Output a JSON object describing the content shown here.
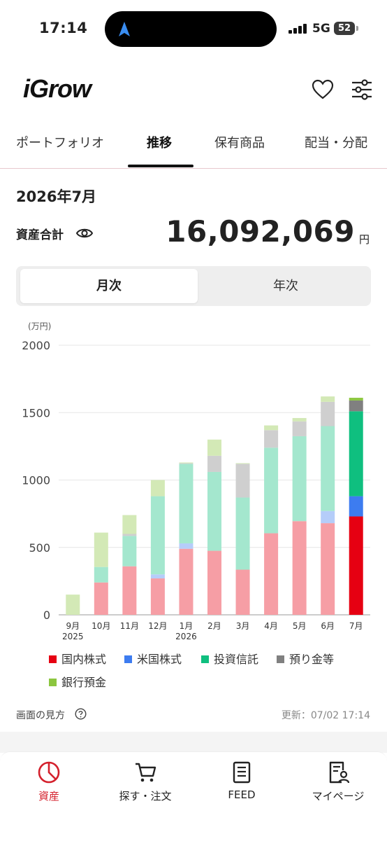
{
  "status": {
    "time": "17:14",
    "network": "5G",
    "battery": "52"
  },
  "app": {
    "logo": "iGrow",
    "icons": [
      "heart-icon",
      "sliders-icon"
    ]
  },
  "tabs": [
    {
      "label": "ポートフォリオ",
      "active": false
    },
    {
      "label": "推移",
      "active": true
    },
    {
      "label": "保有商品",
      "active": false
    },
    {
      "label": "配当・分配",
      "active": false
    }
  ],
  "summary": {
    "month": "2026年7月",
    "asset_label": "資産合計",
    "asset_value": "16,092,069",
    "unit": "円"
  },
  "segment": {
    "monthly": "月次",
    "yearly": "年次",
    "selected": "月次"
  },
  "chart_data": {
    "type": "bar",
    "stacked": true,
    "unit_label": "(万円)",
    "ylim": [
      0,
      2000
    ],
    "yticks": [
      0,
      500,
      1000,
      1500,
      2000
    ],
    "grid": true,
    "categories": [
      "9月\n2025",
      "10月",
      "11月",
      "12月",
      "1月\n2026",
      "2月",
      "3月",
      "4月",
      "5月",
      "6月",
      "7月"
    ],
    "series": [
      {
        "name": "国内株式",
        "color": "#e60012",
        "values": [
          0,
          240,
          360,
          270,
          490,
          475,
          335,
          605,
          695,
          680,
          730
        ]
      },
      {
        "name": "米国株式",
        "color": "#3d7cf0",
        "values": [
          0,
          0,
          0,
          30,
          40,
          0,
          0,
          0,
          0,
          90,
          150
        ]
      },
      {
        "name": "投資信託",
        "color": "#0fbf7f",
        "values": [
          0,
          115,
          225,
          580,
          590,
          585,
          535,
          635,
          630,
          630,
          630
        ]
      },
      {
        "name": "預り金等",
        "color": "#808080",
        "values": [
          0,
          0,
          15,
          0,
          5,
          120,
          250,
          130,
          110,
          180,
          80
        ]
      },
      {
        "name": "銀行預金",
        "color": "#8cc63f",
        "values": [
          150,
          255,
          140,
          120,
          5,
          120,
          5,
          35,
          25,
          40,
          20
        ]
      }
    ]
  },
  "footer": {
    "howto": "画面の見方",
    "updated": "更新：07/02 17:14"
  },
  "bottom_nav": [
    {
      "label": "資産",
      "icon": "pie-chart-icon",
      "active": true
    },
    {
      "label": "探す・注文",
      "icon": "cart-icon",
      "active": false
    },
    {
      "label": "FEED",
      "icon": "feed-icon",
      "active": false
    },
    {
      "label": "マイページ",
      "icon": "mypage-icon",
      "active": false
    }
  ]
}
